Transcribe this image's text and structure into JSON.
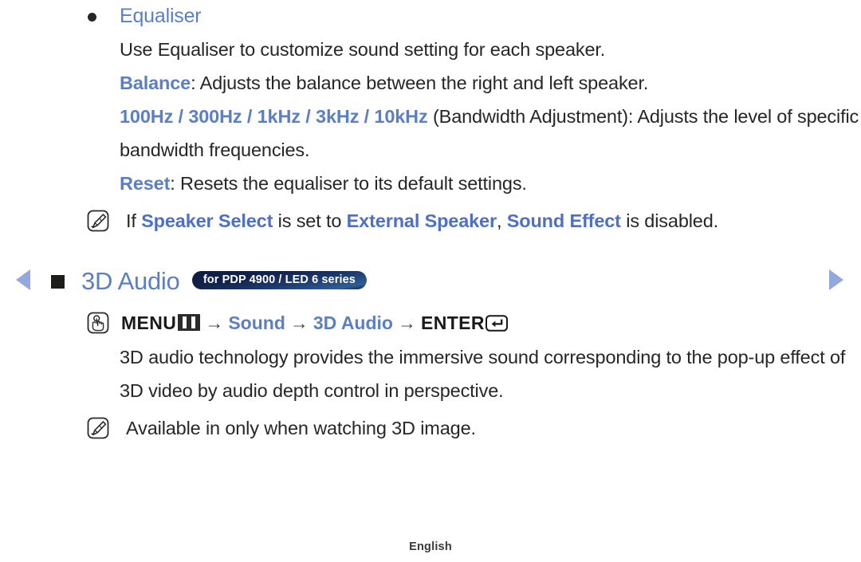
{
  "page": {
    "footer_language": "English",
    "accent_blue": "#5b7fc4",
    "note_blue": "#4d6fc6",
    "text_color": "#262626",
    "arrow_color": "#93a8dd",
    "badge_gradient_from": "#0d1b3e",
    "badge_gradient_to": "#2f5e96"
  },
  "nav": {
    "prev_label": "previous page",
    "next_label": "next page"
  },
  "equaliser": {
    "title": "Equaliser",
    "description": "Use Equaliser to customize sound setting for each speaker.",
    "items": [
      {
        "term": "Balance",
        "sep": ": ",
        "text": "Adjusts the balance between the right and left speaker."
      },
      {
        "term": "100Hz / 300Hz / 1kHz / 3kHz / 10kHz",
        "sep": " ",
        "text": "(Bandwidth Adjustment): Adjusts the level of specific bandwidth frequencies."
      },
      {
        "term": "Reset",
        "sep": ": ",
        "text": "Resets the equaliser to its default settings."
      }
    ],
    "note": {
      "icon": "note-pencil-icon",
      "part1": "If ",
      "kw1": "Speaker Select",
      "part2": " is set to ",
      "kw2": "External Speaker",
      "part3": ", ",
      "kw3": "Sound Effect",
      "part4": " is disabled."
    }
  },
  "audio3d": {
    "heading": "3D Audio",
    "badge": "for PDP 4900 / LED 6 series",
    "path": {
      "icon": "press-button-icon",
      "menu_label": "MENU",
      "menu_glyph": "menu-bars-glyph",
      "arrow": "→",
      "step1": "Sound",
      "step2": "3D Audio",
      "enter_label": "ENTER",
      "enter_glyph": "enter-return-glyph"
    },
    "description": "3D audio technology provides the immersive sound corresponding to the pop-up effect of 3D video by audio depth control in perspective.",
    "note": {
      "icon": "note-pencil-icon",
      "text": "Available in only when watching 3D image."
    }
  }
}
